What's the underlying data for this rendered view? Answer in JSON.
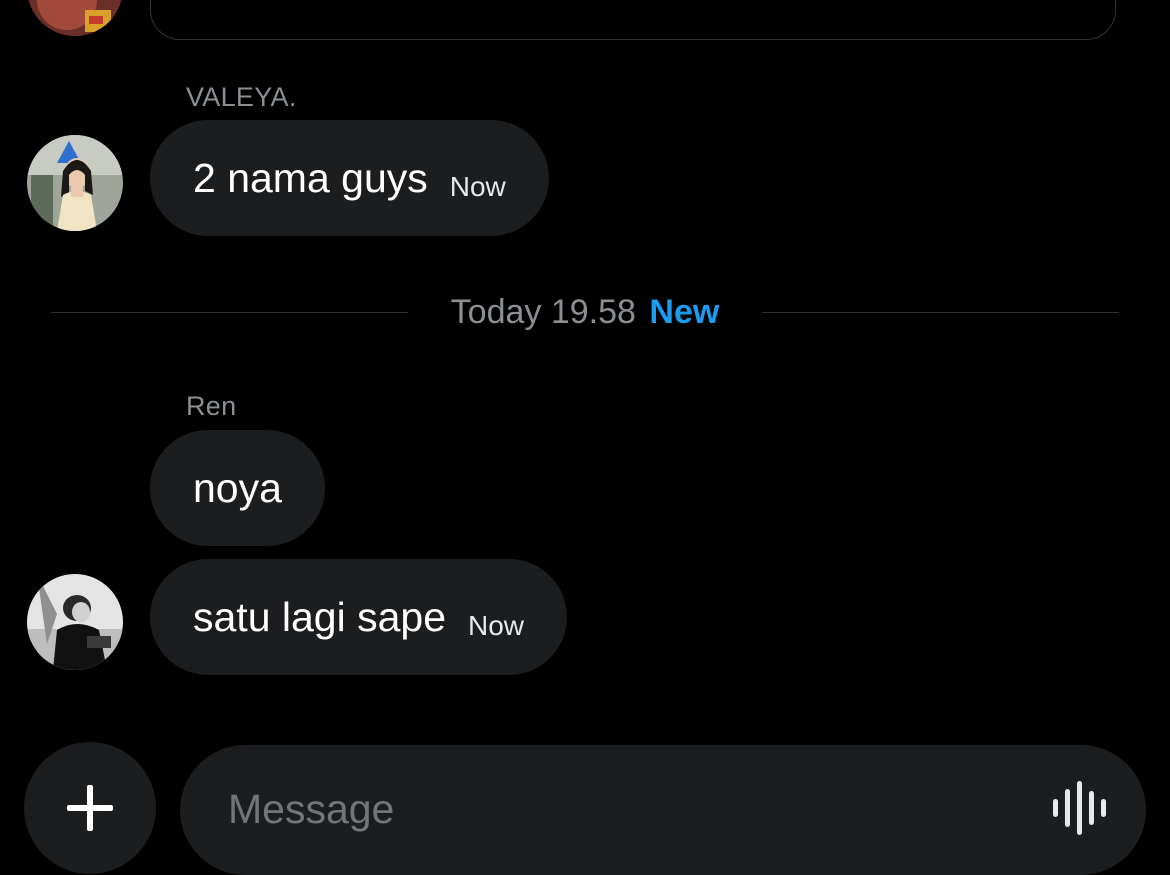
{
  "conversation": {
    "messages": [
      {
        "sender": "VALEYA.",
        "text": "2 nama guys",
        "time": "Now"
      },
      {
        "sender": "Ren",
        "text": "noya",
        "time": ""
      },
      {
        "sender": "Ren",
        "text": "satu lagi sape",
        "time": "Now"
      }
    ],
    "divider": {
      "time_label": "Today 19.58",
      "new_label": "New"
    }
  },
  "composer": {
    "placeholder": "Message",
    "add_icon": "plus-icon",
    "voice_icon": "voice-waveform-icon"
  },
  "colors": {
    "background": "#000000",
    "bubble": "#1c1d1f",
    "accent": "#1d9bf0",
    "muted_text": "#8b8f94"
  }
}
